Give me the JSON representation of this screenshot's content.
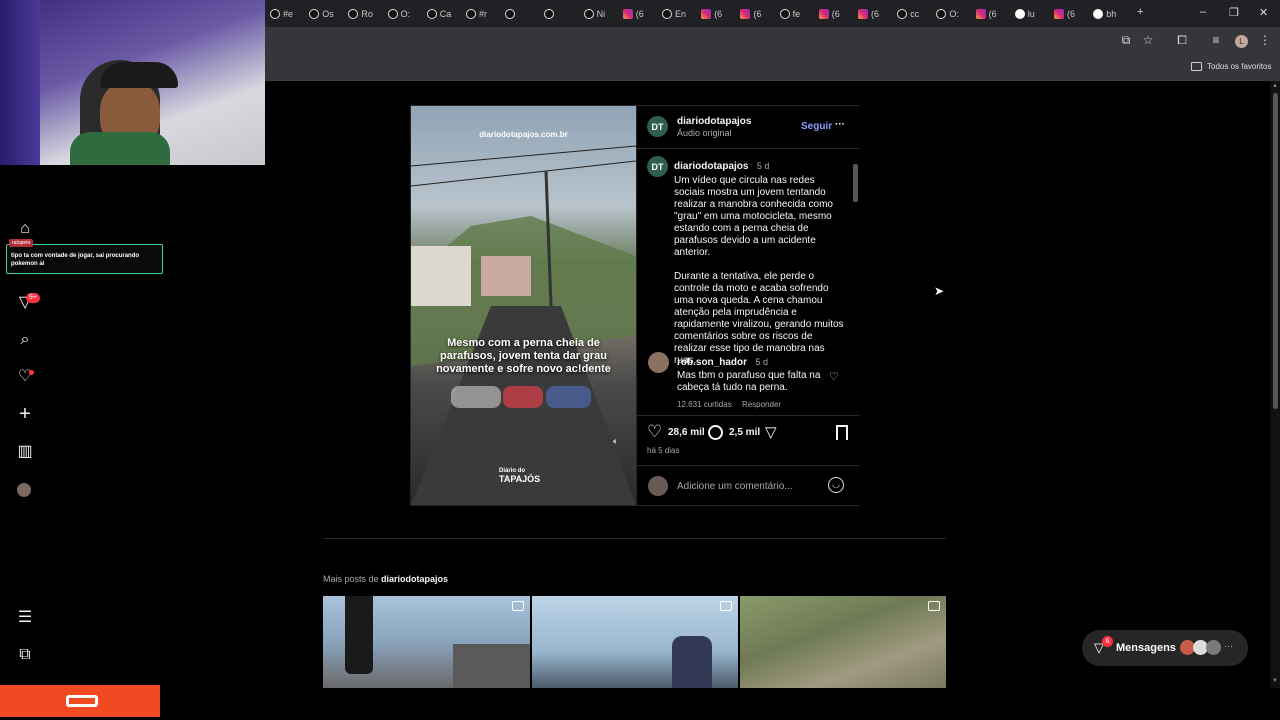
{
  "browser": {
    "tabs": [
      {
        "icon": "tiktok-icon",
        "label": "#e"
      },
      {
        "icon": "tiktok-icon",
        "label": "Os"
      },
      {
        "icon": "tiktok-icon",
        "label": "Ro"
      },
      {
        "icon": "tiktok-icon",
        "label": "O:"
      },
      {
        "icon": "tiktok-icon",
        "label": "Ca"
      },
      {
        "icon": "tiktok-icon",
        "label": "#r"
      },
      {
        "icon": "tiktok-icon",
        "label": ""
      },
      {
        "icon": "tiktok-icon",
        "label": ""
      },
      {
        "icon": "tiktok-icon",
        "label": "Ni"
      },
      {
        "icon": "instagram-icon",
        "label": "(6"
      },
      {
        "icon": "tiktok-icon",
        "label": "En"
      },
      {
        "icon": "instagram-icon",
        "label": "(6"
      },
      {
        "icon": "instagram-icon",
        "label": "(6"
      },
      {
        "icon": "tiktok-icon",
        "label": "fe"
      },
      {
        "icon": "instagram-icon",
        "label": "(6"
      },
      {
        "icon": "instagram-icon",
        "label": "(6"
      },
      {
        "icon": "tiktok-icon",
        "label": "cc"
      },
      {
        "icon": "tiktok-icon",
        "label": "O:"
      },
      {
        "icon": "instagram-icon",
        "label": "(6"
      },
      {
        "icon": "google-icon",
        "label": "lu"
      },
      {
        "icon": "instagram-icon",
        "label": "(6"
      },
      {
        "icon": "google-icon",
        "label": "bh"
      }
    ],
    "new_tab_label": "+",
    "bookmarks_label": "Todos os favoritos",
    "profile_initial": "L"
  },
  "chat_overlay": {
    "user": "ratopeto",
    "message": "tipo ta com vontade de jogar, sai procurando pokemon ai"
  },
  "nav": {
    "notification_badge": "9+"
  },
  "post": {
    "username": "diariodotapajos",
    "audio": "Áudio original",
    "follow_label": "Seguir",
    "more_label": "···",
    "video_watermark": "diariodotapajos.com.br",
    "video_caption": "Mesmo com a perna cheia de parafusos, jovem tenta dar grau novamente e sofre novo ac!dente",
    "video_logo_small": "Diário do",
    "video_logo": "TAPAJÓS",
    "caption_author": "diariodotapajos",
    "caption_age": "5 d",
    "caption_p1": "Um vídeo que circula nas redes sociais mostra um jovem tentando realizar a manobra conhecida como \"grau\" em uma motocicleta, mesmo estando com a perna cheia de parafusos devido a um acidente anterior.",
    "caption_p2": "Durante a tentativa, ele perde o controle da moto e acaba sofrendo uma nova queda. A cena chamou atenção pela imprudência e rapidamente viralizou, gerando muitos comentários sobre os riscos de realizar esse tipo de manobra nas ruas.",
    "comment": {
      "author": "rob.son_hador",
      "age": "5 d",
      "text": "Mas tbm o parafuso que falta na cabeça tá tudo na perna.",
      "likes": "12.631 curtidas",
      "reply_label": "Responder"
    },
    "likes_count": "28,6 mil",
    "comments_count": "2,5 mil",
    "posted_ago": "há 5 dias",
    "add_comment_placeholder": "Adicione um comentário..."
  },
  "more_posts": {
    "prefix": "Mais posts de",
    "username": "diariodotapajos"
  },
  "messages": {
    "label": "Mensagens",
    "badge": "6"
  },
  "colors": {
    "accent": "#0095f6",
    "follow": "#8c9bff",
    "badge_red": "#ff3040",
    "avatar_green": "#2e5f4a",
    "taskbar_orange": "#f04a23"
  }
}
